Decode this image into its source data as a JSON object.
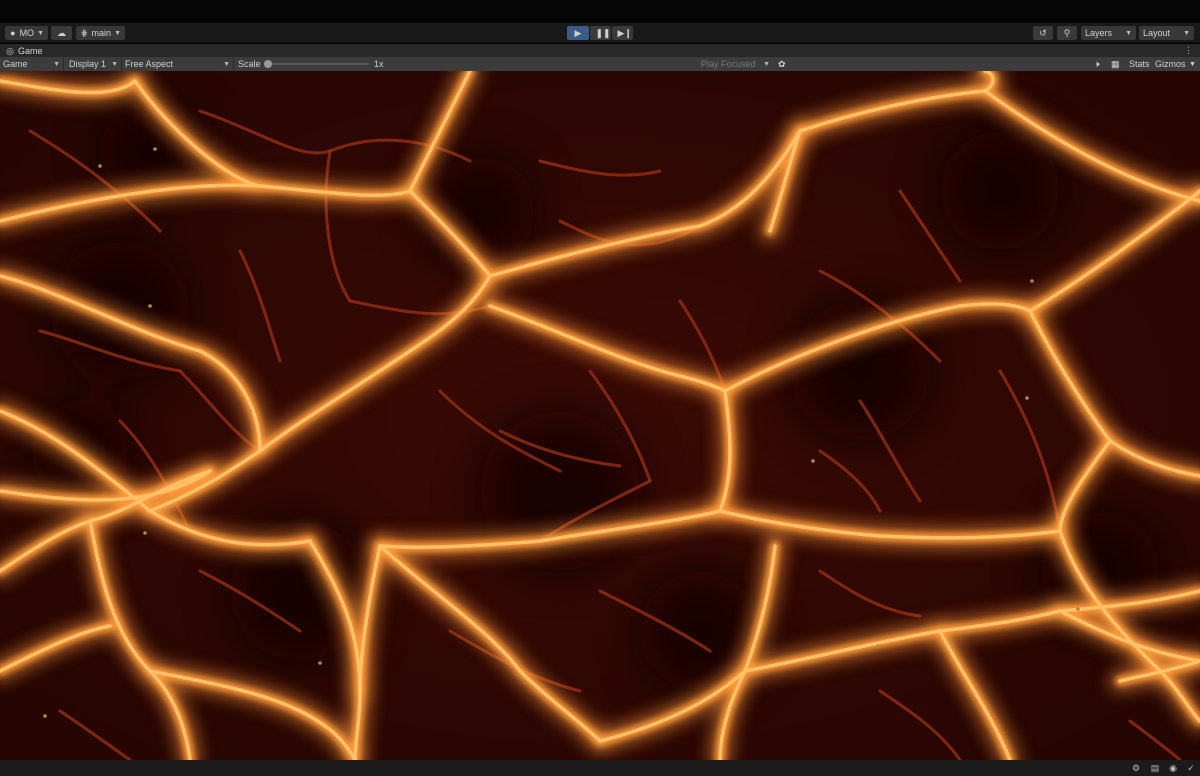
{
  "toolbar": {
    "account_label": "MO",
    "branch_label": "main",
    "layers_label": "Layers",
    "layout_label": "Layout"
  },
  "tab": {
    "title": "Game"
  },
  "game_bar": {
    "view_mode": "Game",
    "display": "Display 1",
    "aspect": "Free Aspect",
    "scale_label": "Scale",
    "scale_value": "1x",
    "scale_fraction": 0,
    "play_mode": "Play Focused",
    "stats_label": "Stats",
    "gizmos_label": "Gizmos"
  },
  "colors": {
    "play_active": "#395b86",
    "lava_glow": "#ff9a3c",
    "lava_core": "#ffc36a",
    "lava_dark": "#2a0703"
  },
  "icons": [
    "account-icon",
    "cloud-icon",
    "branch-icon",
    "play-icon",
    "pause-icon",
    "step-icon",
    "history-icon",
    "search-icon",
    "game-controller-icon",
    "kebab-menu-icon",
    "bug-icon",
    "audio-icon",
    "keyboard-icon",
    "statusbar-icons"
  ]
}
